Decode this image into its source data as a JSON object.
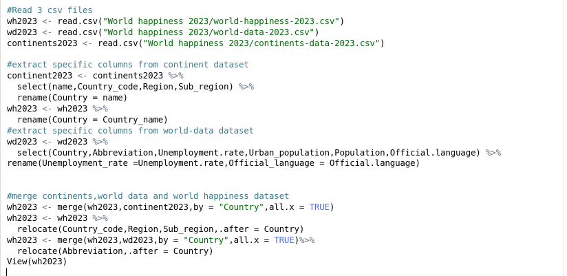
{
  "lines": [
    [
      {
        "t": "#Read 3 csv files",
        "c": "comment"
      }
    ],
    [
      {
        "t": "wh2023 ",
        "c": "plain"
      },
      {
        "t": "<-",
        "c": "op"
      },
      {
        "t": " read.csv(",
        "c": "plain"
      },
      {
        "t": "\"World happiness 2023/world-happiness-2023.csv\"",
        "c": "str"
      },
      {
        "t": ")",
        "c": "plain"
      }
    ],
    [
      {
        "t": "wd2023 ",
        "c": "plain"
      },
      {
        "t": "<-",
        "c": "op"
      },
      {
        "t": " read.csv(",
        "c": "plain"
      },
      {
        "t": "\"World happiness 2023/world-data-2023.csv\"",
        "c": "str"
      },
      {
        "t": ")",
        "c": "plain"
      }
    ],
    [
      {
        "t": "continents2023 ",
        "c": "plain"
      },
      {
        "t": "<-",
        "c": "op"
      },
      {
        "t": " read.csv(",
        "c": "plain"
      },
      {
        "t": "\"World happiness 2023/continents-data-2023.csv\"",
        "c": "str"
      },
      {
        "t": ")",
        "c": "plain"
      }
    ],
    [
      {
        "t": "",
        "c": "plain"
      }
    ],
    [
      {
        "t": "#extract specific columns from continent dataset",
        "c": "comment"
      }
    ],
    [
      {
        "t": "continent2023 ",
        "c": "plain"
      },
      {
        "t": "<-",
        "c": "op"
      },
      {
        "t": " continents2023 ",
        "c": "plain"
      },
      {
        "t": "%>%",
        "c": "op"
      }
    ],
    [
      {
        "t": "  select(name,Country_code,Region,Sub_region) ",
        "c": "plain"
      },
      {
        "t": "%>%",
        "c": "op"
      }
    ],
    [
      {
        "t": "  rename(Country = name)",
        "c": "plain"
      }
    ],
    [
      {
        "t": "wh2023 ",
        "c": "plain"
      },
      {
        "t": "<-",
        "c": "op"
      },
      {
        "t": " wh2023 ",
        "c": "plain"
      },
      {
        "t": "%>%",
        "c": "op"
      }
    ],
    [
      {
        "t": "  rename(Country = Country_name)",
        "c": "plain"
      }
    ],
    [
      {
        "t": "#extract specific columns from world-data dataset",
        "c": "comment"
      }
    ],
    [
      {
        "t": "wd2023 ",
        "c": "plain"
      },
      {
        "t": "<-",
        "c": "op"
      },
      {
        "t": " wd2023 ",
        "c": "plain"
      },
      {
        "t": "%>%",
        "c": "op"
      }
    ],
    [
      {
        "t": "  select(Country,Abbreviation,Unemployment.rate,Urban_population,Population,Official.language) ",
        "c": "plain"
      },
      {
        "t": "%>%",
        "c": "op"
      }
    ],
    [
      {
        "t": "rename(Unemployment_rate =Unemployment.rate,Official_language = Official.language)",
        "c": "plain"
      }
    ],
    [
      {
        "t": "",
        "c": "plain"
      }
    ],
    [
      {
        "t": "",
        "c": "plain"
      }
    ],
    [
      {
        "t": "#merge continents,world data and world happiness dataset",
        "c": "comment"
      }
    ],
    [
      {
        "t": "wh2023 ",
        "c": "plain"
      },
      {
        "t": "<-",
        "c": "op"
      },
      {
        "t": " merge(wh2023,continent2023,by = ",
        "c": "plain"
      },
      {
        "t": "\"Country\"",
        "c": "str"
      },
      {
        "t": ",all.x = ",
        "c": "plain"
      },
      {
        "t": "TRUE",
        "c": "kw"
      },
      {
        "t": ")",
        "c": "plain"
      }
    ],
    [
      {
        "t": "wh2023 ",
        "c": "plain"
      },
      {
        "t": "<-",
        "c": "op"
      },
      {
        "t": " wh2023 ",
        "c": "plain"
      },
      {
        "t": "%>%",
        "c": "op"
      }
    ],
    [
      {
        "t": "  relocate(Country_code,Region,Sub_region,.after = Country)",
        "c": "plain"
      }
    ],
    [
      {
        "t": "wh2023 ",
        "c": "plain"
      },
      {
        "t": "<-",
        "c": "op"
      },
      {
        "t": " merge(wh2023,wd2023,by = ",
        "c": "plain"
      },
      {
        "t": "\"Country\"",
        "c": "str"
      },
      {
        "t": ",all.x = ",
        "c": "plain"
      },
      {
        "t": "TRUE",
        "c": "kw"
      },
      {
        "t": ")",
        "c": "plain"
      },
      {
        "t": "%>%",
        "c": "op"
      }
    ],
    [
      {
        "t": "  relocate(Abbreviation,.after = Country)",
        "c": "plain"
      }
    ],
    [
      {
        "t": "View(wh2023)",
        "c": "plain"
      }
    ]
  ]
}
